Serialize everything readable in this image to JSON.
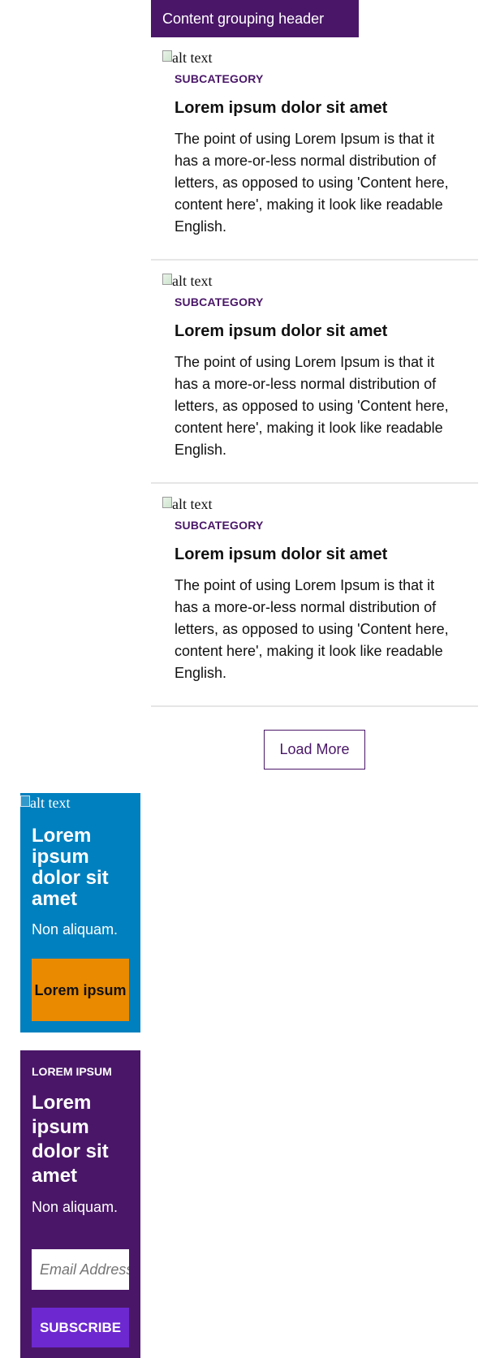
{
  "header": {
    "title": "Content grouping header"
  },
  "cards": [
    {
      "img_alt": "alt text",
      "subcategory": "SUBCATEGORY",
      "title": "Lorem ipsum dolor sit amet",
      "body": "The point of using Lorem Ipsum is that it has a more-or-less normal distribution of letters, as opposed to using 'Content here, content here', making it look like readable English."
    },
    {
      "img_alt": "alt text",
      "subcategory": "SUBCATEGORY",
      "title": "Lorem ipsum dolor sit amet",
      "body": "The point of using Lorem Ipsum is that it has a more-or-less normal distribution of letters, as opposed to using 'Content here, content here', making it look like readable English."
    },
    {
      "img_alt": "alt text",
      "subcategory": "SUBCATEGORY",
      "title": "Lorem ipsum dolor sit amet",
      "body": "The point of using Lorem Ipsum is that it has a more-or-less normal distribution of letters, as opposed to using 'Content here, content here', making it look like readable English."
    }
  ],
  "load_more": {
    "label": "Load More"
  },
  "promo_blue": {
    "img_alt": "alt text",
    "headline": "Lorem ipsum dolor sit amet",
    "subtext": "Non aliquam.",
    "cta_label": "Lorem ipsum",
    "bg_color": "#0080bf",
    "cta_color": "#e98a00"
  },
  "promo_purple": {
    "eyebrow": "LOREM IPSUM",
    "headline": "Lorem ipsum dolor sit amet",
    "subtext": "Non aliquam.",
    "email_placeholder": "Email Address",
    "subscribe_label": "SUBSCRIBE",
    "bg_color": "#4a1768",
    "button_color": "#6d28d0"
  },
  "theme": {
    "brand_purple": "#4a1768",
    "divider": "#e6e6e6"
  }
}
